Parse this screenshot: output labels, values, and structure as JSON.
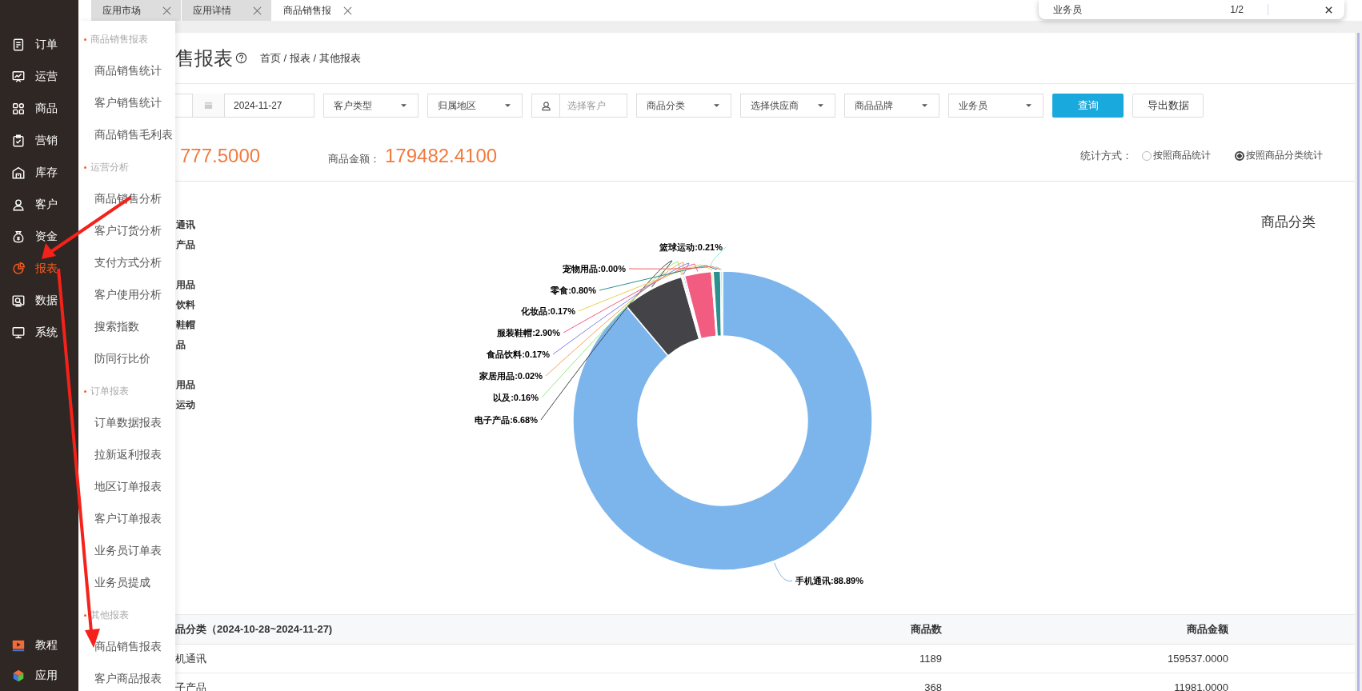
{
  "sidebar": {
    "items": [
      {
        "label": "订单",
        "selected": false
      },
      {
        "label": "运营",
        "selected": false
      },
      {
        "label": "商品",
        "selected": false
      },
      {
        "label": "营销",
        "selected": false
      },
      {
        "label": "库存",
        "selected": false
      },
      {
        "label": "客户",
        "selected": false
      },
      {
        "label": "资金",
        "selected": false
      },
      {
        "label": "报表",
        "selected": true
      },
      {
        "label": "数据",
        "selected": false
      },
      {
        "label": "系统",
        "selected": false
      }
    ],
    "bottom_items": [
      {
        "label": "教程"
      },
      {
        "label": "应用"
      }
    ]
  },
  "flyout_menu": {
    "groups": [
      {
        "title": "商品销售报表",
        "items": [
          "商品销售统计",
          "客户销售统计",
          "商品销售毛利表"
        ]
      },
      {
        "title": "运营分析",
        "items": [
          "商品销售分析",
          "客户订货分析",
          "支付方式分析",
          "客户使用分析",
          "搜索指数",
          "防同行比价"
        ]
      },
      {
        "title": "订单报表",
        "items": [
          "订单数据报表",
          "拉新返利报表",
          "地区订单报表",
          "客户订单报表",
          "业务员订单表",
          "业务员提成"
        ]
      },
      {
        "title": "其他报表",
        "items": [
          "商品销售报表",
          "客户商品报表"
        ]
      }
    ]
  },
  "tabs": [
    {
      "label": "应用市场",
      "selected": false
    },
    {
      "label": "应用详情",
      "selected": false
    },
    {
      "label": "商品销售报",
      "selected": true
    }
  ],
  "find_bar": {
    "text": "业务员",
    "count": "1/2"
  },
  "page": {
    "title": "售报表",
    "breadcrumb": "首页 / 报表 / 其他报表"
  },
  "filters": {
    "end_date": "2024-11-27",
    "fields": [
      {
        "kind": "select",
        "label": "客户类型"
      },
      {
        "kind": "select",
        "label": "归属地区"
      },
      {
        "kind": "customer",
        "placeholder": "选择客户"
      },
      {
        "kind": "select",
        "label": "商品分类"
      },
      {
        "kind": "select",
        "label": "选择供应商"
      },
      {
        "kind": "select",
        "label": "商品品牌"
      },
      {
        "kind": "select",
        "label": "业务员"
      }
    ],
    "buttons": [
      {
        "label": "查询",
        "kind": "primary"
      },
      {
        "label": "导出数据",
        "kind": "default"
      }
    ]
  },
  "stats": [
    {
      "value": "777.5000"
    },
    {
      "label": "商品金额：",
      "value": "179482.4100"
    }
  ],
  "stat_mode": {
    "label": "统计方式：",
    "options": [
      {
        "label": "按照商品统计",
        "selected": false
      },
      {
        "label": "按照商品分类统计",
        "selected": true
      }
    ]
  },
  "chart": {
    "legend_groups": [
      [
        "通讯",
        "产品"
      ],
      [
        "用品",
        "饮料",
        "鞋帽",
        "品"
      ],
      [
        "用品",
        "运动"
      ]
    ],
    "chart_data": {
      "type": "donut",
      "title": "商品分类",
      "categories": [
        "手机通讯",
        "电子产品",
        "以及",
        "家居用品",
        "食品饮料",
        "服装鞋帽",
        "化妆品",
        "零食",
        "宠物用品",
        "篮球运动"
      ],
      "values": [
        88.89,
        6.68,
        0.16,
        0.02,
        0.17,
        2.9,
        0.17,
        0.8,
        0.0,
        0.21
      ],
      "value_labels": [
        ":88.89%",
        ":6.68%",
        ":0.16%",
        ":0.02%",
        ":0.17%",
        ":2.90%",
        ":0.17%",
        ":0.80%",
        ":0.00%",
        ":0.21%"
      ]
    }
  },
  "table": {
    "columns": [
      "品分类（2024-10-28~2024-11-27)",
      "商品数",
      "商品金额"
    ],
    "rows": [
      [
        "机通讯",
        "1189",
        "159537.0000"
      ],
      [
        "子产品",
        "368",
        "11981.0000"
      ]
    ]
  }
}
